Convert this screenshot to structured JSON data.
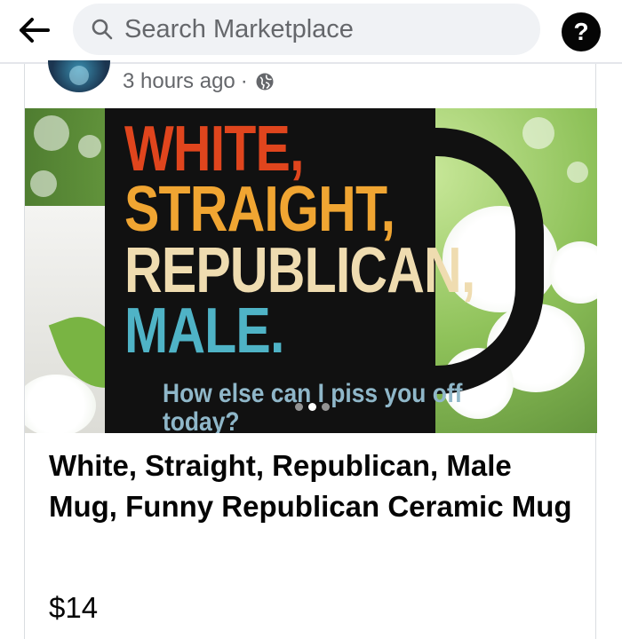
{
  "header": {
    "search_placeholder": "Search Marketplace"
  },
  "post": {
    "timestamp": "3 hours ago",
    "separator": "·",
    "privacy_icon": "globe-icon"
  },
  "photo": {
    "mug_lines": [
      "WHITE,",
      "STRAIGHT,",
      "REPUBLICAN,",
      "MALE."
    ],
    "mug_tagline": "How else can I piss you off today?",
    "carousel": {
      "count": 3,
      "active_index": 1
    }
  },
  "listing": {
    "title": "White, Straight, Republican, Male Mug, Funny Republican Ceramic Mug",
    "price": "$14"
  },
  "colors": {
    "accent_dark": "#050505",
    "search_bg": "#f0f2f5",
    "mug_red": "#e0451d",
    "mug_orange": "#f0a532",
    "mug_cream": "#efdcb0",
    "mug_teal": "#4fb3c6"
  }
}
